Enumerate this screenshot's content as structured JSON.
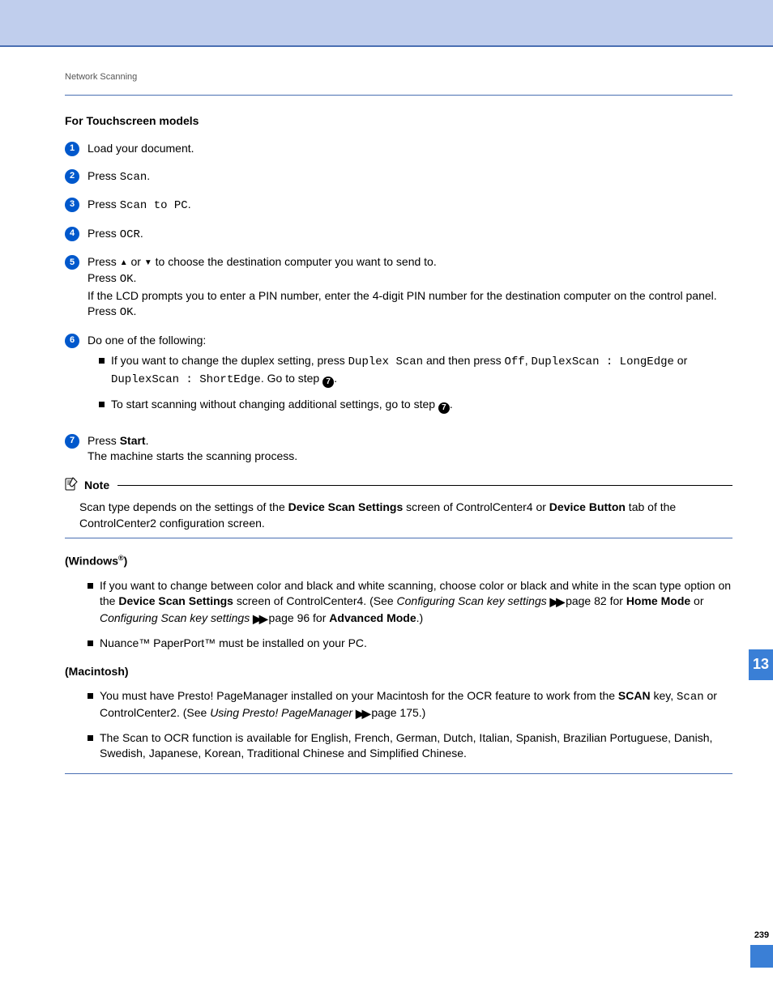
{
  "breadcrumb": "Network Scanning",
  "section_heading": "For Touchscreen models",
  "steps": {
    "s1": "Load your document.",
    "s2_pre": "Press ",
    "s2_mono": "Scan",
    "s3_pre": "Press ",
    "s3_mono": "Scan to PC",
    "s4_pre": "Press ",
    "s4_mono": "OCR",
    "s5_l1a": "Press ",
    "s5_l1b": " or ",
    "s5_l1c": " to choose the destination computer you want to send to.",
    "s5_l2a": "Press ",
    "s5_l2b": "OK",
    "s5_l3": "If the LCD prompts you to enter a PIN number, enter the 4-digit PIN number for the destination computer on the control panel.",
    "s5_l4a": "Press ",
    "s5_l4b": "OK",
    "s6_l1": "Do one of the following:",
    "s6_b1a": "If you want to change the duplex setting, press ",
    "s6_b1m1": "Duplex Scan",
    "s6_b1b": " and then press ",
    "s6_b1m2": "Off",
    "s6_b1c": ", ",
    "s6_b1m3": "DuplexScan : LongEdge",
    "s6_b1d": " or ",
    "s6_b1m4": "DuplexScan : ShortEdge",
    "s6_b1e": ". Go to step ",
    "s6_b2a": "To start scanning without changing additional settings, go to step ",
    "s7_l1a": "Press ",
    "s7_l1b": "Start",
    "s7_l2": "The machine starts the scanning process."
  },
  "note": {
    "title": "Note",
    "body_a": "Scan type depends on the settings of the ",
    "body_b": "Device Scan Settings",
    "body_c": " screen of ControlCenter4 or ",
    "body_d": "Device Button",
    "body_e": " tab of the ControlCenter2 configuration screen."
  },
  "win": {
    "heading_a": "(Windows",
    "heading_b": ")",
    "b1a": "If you want to change between color and black and white scanning, choose color or black and white in the scan type option on the ",
    "b1b": "Device Scan Settings",
    "b1c": " screen of ControlCenter4. (See ",
    "b1d": "Configuring Scan key settings",
    "b1e": " page 82 for ",
    "b1f": "Home Mode",
    "b1g": " or ",
    "b1h": "Configuring Scan key settings",
    "b1i": " page 96 for ",
    "b1j": "Advanced Mode",
    "b1k": ".)",
    "b2": "Nuance™ PaperPort™ must be installed on your PC."
  },
  "mac": {
    "heading": "(Macintosh)",
    "b1a": "You must have Presto! PageManager installed on your Macintosh for the OCR feature to work from the ",
    "b1b": "SCAN",
    "b1c": " key, ",
    "b1m": "Scan",
    "b1d": " or ControlCenter2. (See ",
    "b1e": "Using Presto! PageManager",
    "b1f": " page 175.)",
    "b2": "The Scan to OCR function is available for English, French, German, Dutch, Italian, Spanish, Brazilian Portuguese, Danish, Swedish, Japanese, Korean, Traditional Chinese and Simplified Chinese."
  },
  "side_tab": "13",
  "page_number": "239",
  "glyphs": {
    "up": "▲",
    "down": "▼",
    "reg": "®",
    "dbl": "▶▶"
  }
}
